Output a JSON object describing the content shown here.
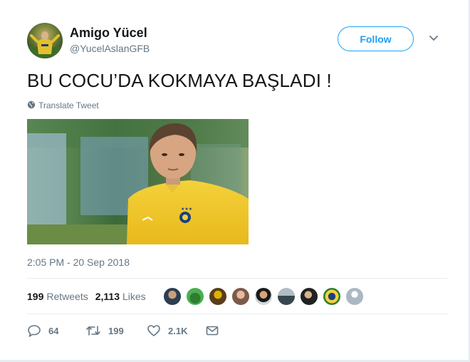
{
  "author": {
    "name": "Amigo Yücel",
    "handle": "@YucelAslanGFB"
  },
  "follow_button": {
    "label": "Follow"
  },
  "tweet": {
    "text": "BU COCU’DA KOKMAYA BAŞLADI !",
    "translate_label": "Translate Tweet",
    "timestamp": "2:05 PM - 20 Sep 2018"
  },
  "stats": {
    "retweets_count": "199",
    "retweets_label": "Retweets",
    "likes_count": "2,113",
    "likes_label": "Likes"
  },
  "actions": {
    "reply_count": "64",
    "retweet_count": "199",
    "like_count": "2.1K"
  },
  "icons": {
    "reply": "reply-icon",
    "retweet": "retweet-icon",
    "like": "heart-icon",
    "message": "envelope-icon",
    "globe": "globe-icon",
    "caret": "chevron-down-icon"
  },
  "colors": {
    "accent": "#1da1f2",
    "text": "#14171a",
    "muted": "#657786",
    "divider": "#e6ecf0"
  }
}
